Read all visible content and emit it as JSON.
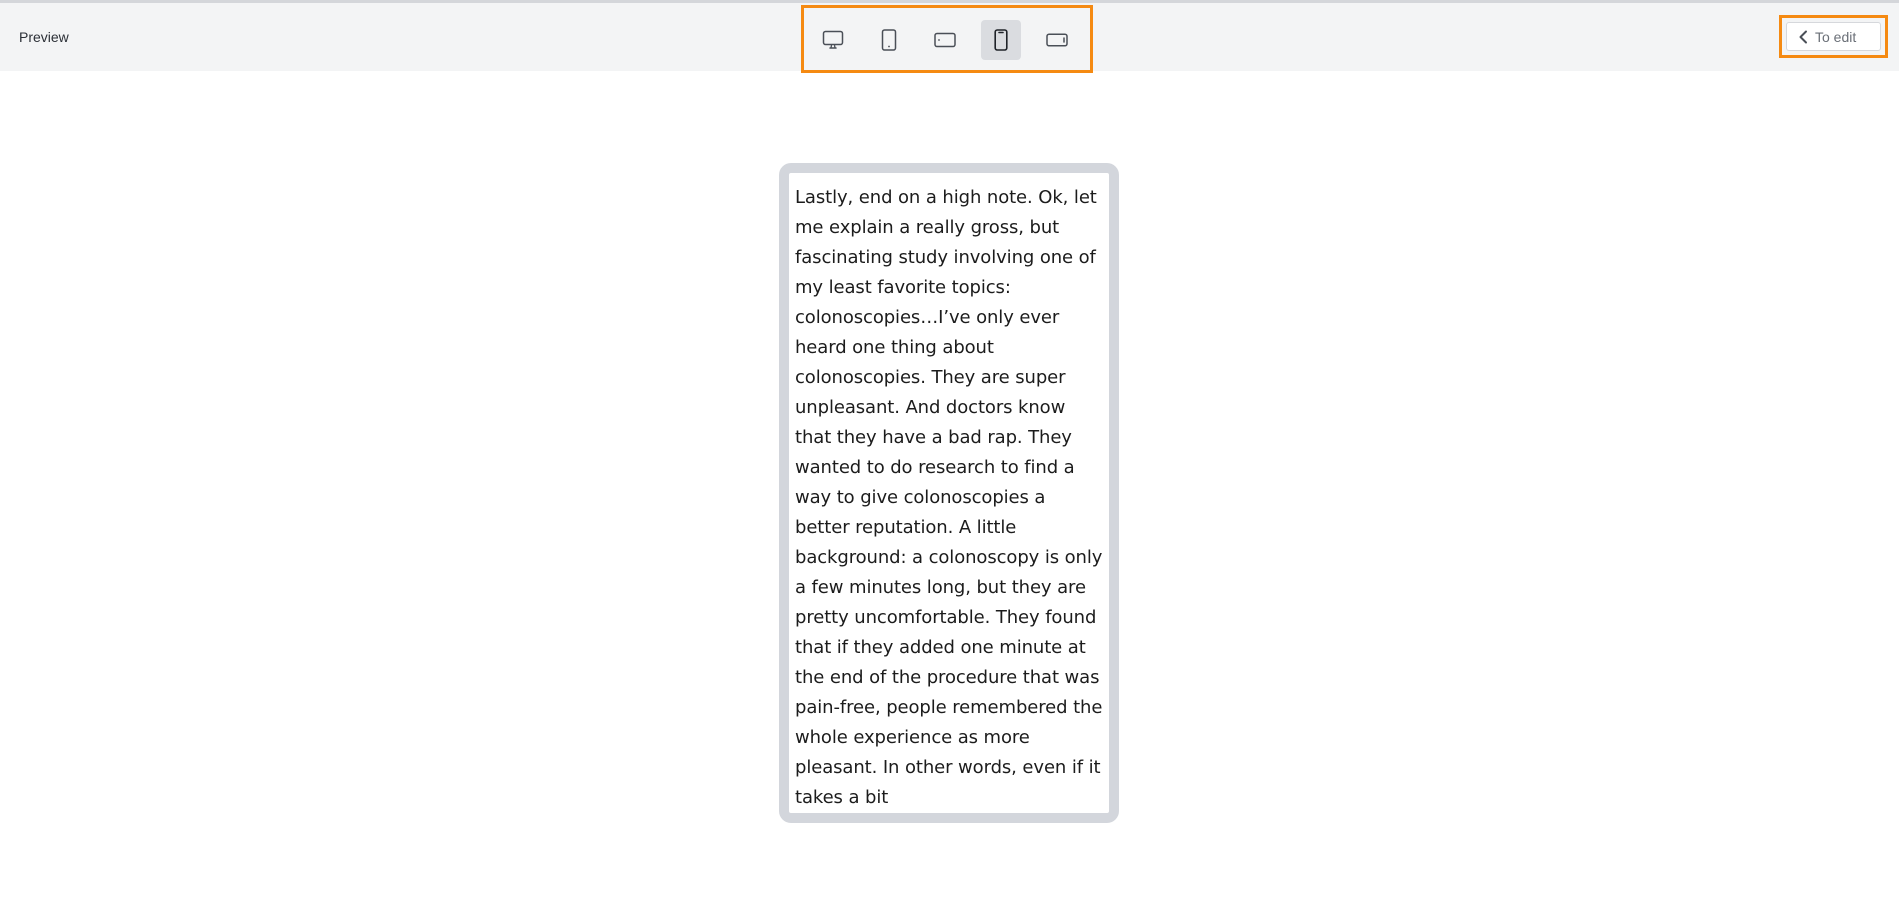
{
  "header": {
    "title": "Preview"
  },
  "devices": [
    {
      "name": "desktop",
      "icon": "monitor-icon",
      "active": false
    },
    {
      "name": "tablet-portrait",
      "icon": "tablet-icon",
      "active": false
    },
    {
      "name": "tablet-landscape",
      "icon": "tablet-landscape-icon",
      "active": false
    },
    {
      "name": "phone-portrait",
      "icon": "phone-icon",
      "active": true
    },
    {
      "name": "phone-landscape",
      "icon": "phone-landscape-icon",
      "active": false
    }
  ],
  "actions": {
    "to_edit_label": "To edit"
  },
  "preview": {
    "body_text": "Lastly, end on a high note. Ok, let me explain a really gross, but fascinating study involving one of my least favorite topics: colonoscopies…I’ve only ever heard one thing about colonoscopies. They are super unpleasant. And doctors know that they have a bad rap. They wanted to do research to find a way to give colonoscopies a better reputation. A little background: a colonoscopy is only a few minutes long, but they are pretty uncomfortable. They found that if they added one minute at the end of the procedure that was pain-free, people remembered the whole experience as more pleasant. In other words, even if it takes a bit"
  },
  "colors": {
    "highlight": "#f58a12",
    "toolbar_bg": "#f3f4f5",
    "active_device_bg": "#dadce0",
    "frame_border": "#d3d6dc"
  }
}
